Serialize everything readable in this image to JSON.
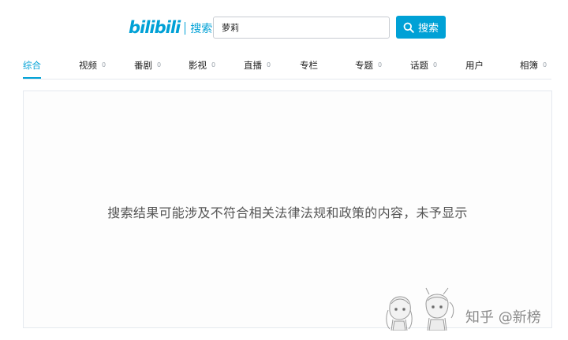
{
  "header": {
    "logo_text": "bilibili",
    "logo_label": "搜索",
    "search_value": "萝莉",
    "search_button_label": "搜索",
    "search_icon": "search-icon"
  },
  "tabs": [
    {
      "label": "综合",
      "count": "",
      "active": true
    },
    {
      "label": "视频",
      "count": "0"
    },
    {
      "label": "番剧",
      "count": "0"
    },
    {
      "label": "影视",
      "count": "0"
    },
    {
      "label": "直播",
      "count": "0"
    },
    {
      "label": "专栏",
      "count": ""
    },
    {
      "label": "专题",
      "count": "0"
    },
    {
      "label": "话题",
      "count": "0"
    },
    {
      "label": "用户",
      "count": ""
    },
    {
      "label": "相簿",
      "count": "0"
    }
  ],
  "main": {
    "notice": "搜索结果可能涉及不符合相关法律法规和政策的内容，未予显示"
  },
  "watermark": {
    "text": "知乎 @新榜"
  },
  "colors": {
    "accent": "#00a1d6",
    "border": "#e5e9ef",
    "muted": "#99a2aa"
  }
}
